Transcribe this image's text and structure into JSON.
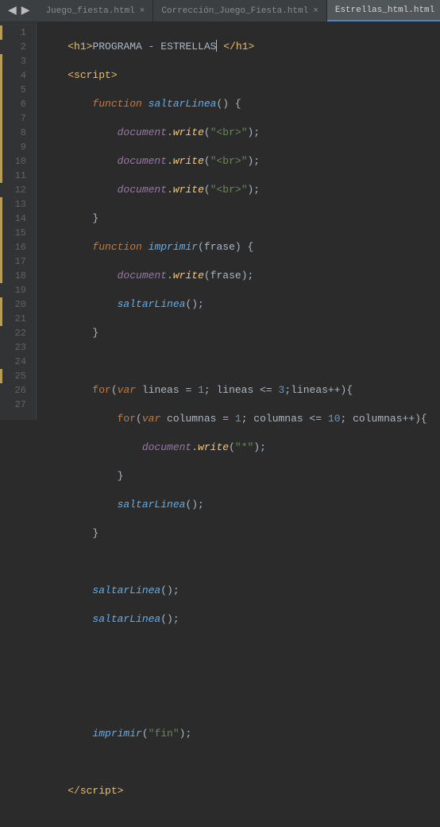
{
  "nav": {
    "back": "◀",
    "forward": "▶"
  },
  "tabs": [
    {
      "label": "Juego_fiesta.html",
      "active": false
    },
    {
      "label": "Corrección_Juego_Fiesta.html",
      "active": false
    },
    {
      "label": "Estrellas_html.html",
      "active": true
    }
  ],
  "lines": [
    1,
    2,
    3,
    4,
    5,
    6,
    7,
    8,
    9,
    10,
    11,
    12,
    13,
    14,
    15,
    16,
    17,
    18,
    19,
    20,
    21,
    22,
    23,
    24,
    25,
    26,
    27
  ],
  "modified": [
    1,
    3,
    4,
    5,
    6,
    7,
    8,
    9,
    10,
    11,
    13,
    14,
    15,
    16,
    17,
    18,
    20,
    21,
    25
  ],
  "code": {
    "l1": {
      "t1": "<",
      "tag": "h1",
      "t2": ">",
      "txt": "PROGRAMA - ESTRELLAS",
      "t3": " </",
      "t4": ">"
    },
    "l2": {
      "t1": "<",
      "tag": "script",
      "t2": ">"
    },
    "l3": {
      "kw": "function",
      "name": "saltarLinea",
      "p": "() {"
    },
    "l4": {
      "obj": "document",
      "dot": ".",
      "m": "write",
      "p1": "(",
      "s": "\"<br>\"",
      "p2": ");"
    },
    "l5": {
      "obj": "document",
      "dot": ".",
      "m": "write",
      "p1": "(",
      "s": "\"<br>\"",
      "p2": ");"
    },
    "l6": {
      "obj": "document",
      "dot": ".",
      "m": "write",
      "p1": "(",
      "s": "\"<br>\"",
      "p2": ");"
    },
    "l7": {
      "b": "}"
    },
    "l8": {
      "kw": "function",
      "name": "imprimir",
      "p1": "(",
      "param": "frase",
      "p2": ") {"
    },
    "l9": {
      "obj": "document",
      "dot": ".",
      "m": "write",
      "p1": "(",
      "param": "frase",
      "p2": ");"
    },
    "l10": {
      "fn": "saltarLinea",
      "p": "();"
    },
    "l11": {
      "b": "}"
    },
    "l13": {
      "kw1": "for",
      "p1": "(",
      "kw2": "var",
      "v1": " lineas = ",
      "n1": "1",
      "s1": "; lineas <= ",
      "n2": "3",
      "s2": ";lineas++){"
    },
    "l14": {
      "kw1": "for",
      "p1": "(",
      "kw2": "var",
      "v1": " columnas = ",
      "n1": "1",
      "s1": "; columnas <= ",
      "n2": "10",
      "s2": "; columnas++){"
    },
    "l15": {
      "obj": "document",
      "dot": ".",
      "m": "write",
      "p1": "(",
      "s": "\"*\"",
      "p2": ");"
    },
    "l16": {
      "b": "}"
    },
    "l17": {
      "fn": "saltarLinea",
      "p": "();"
    },
    "l18": {
      "b": "}"
    },
    "l20": {
      "fn": "saltarLinea",
      "p": "();"
    },
    "l21": {
      "fn": "saltarLinea",
      "p": "();"
    },
    "l25": {
      "fn": "imprimir",
      "p1": "(",
      "s": "\"fin\"",
      "p2": ");"
    },
    "l27": {
      "t1": "</",
      "tag": "script",
      "t2": ">"
    }
  }
}
